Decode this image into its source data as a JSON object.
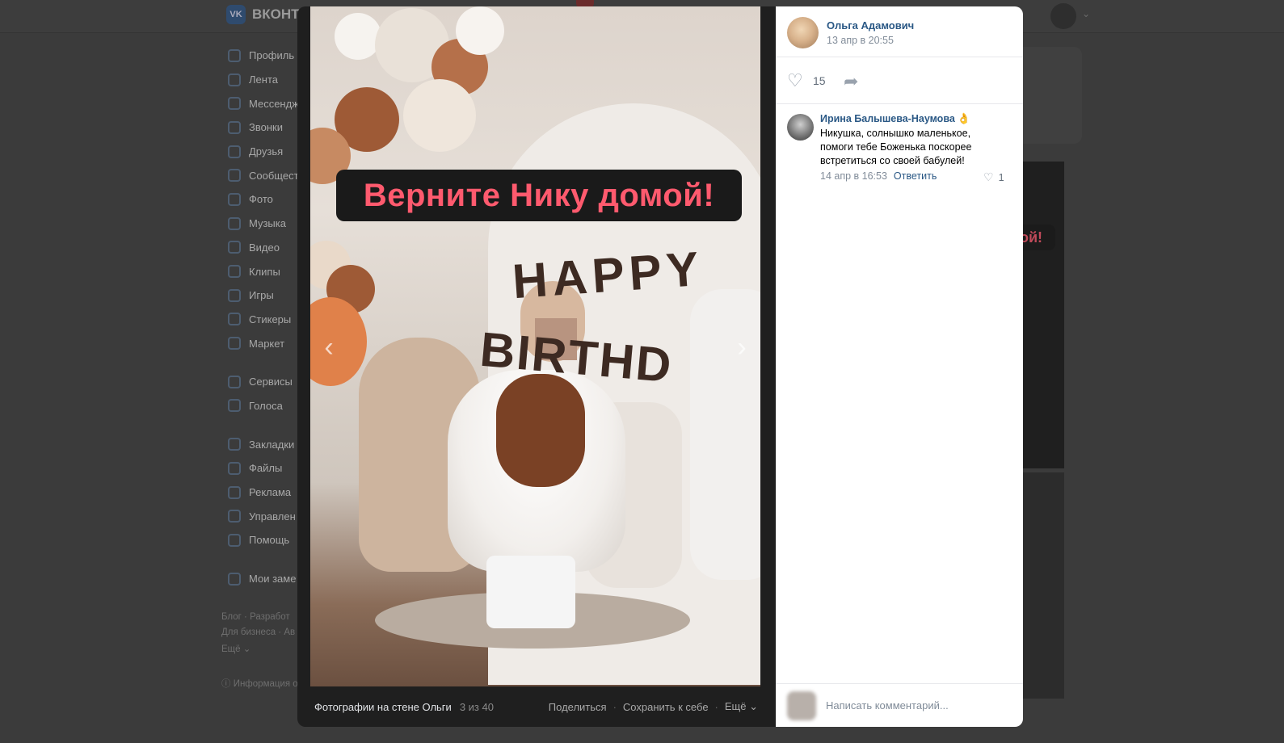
{
  "background": {
    "brand": "ВКОНТ",
    "sidebar": [
      {
        "label": "Профиль"
      },
      {
        "label": "Лента"
      },
      {
        "label": "Мессендж"
      },
      {
        "label": "Звонки"
      },
      {
        "label": "Друзья"
      },
      {
        "label": "Сообщест"
      },
      {
        "label": "Фото"
      },
      {
        "label": "Музыка"
      },
      {
        "label": "Видео"
      },
      {
        "label": "Клипы"
      },
      {
        "label": "Игры"
      },
      {
        "label": "Стикеры"
      },
      {
        "label": "Маркет"
      },
      {
        "label": "Сервисы"
      },
      {
        "label": "Голоса"
      },
      {
        "label": "Закладки"
      },
      {
        "label": "Файлы"
      },
      {
        "label": "Реклама"
      },
      {
        "label": "Управлен"
      },
      {
        "label": "Помощь"
      },
      {
        "label": "Мои заме"
      }
    ],
    "footer_line1": "Блог · Разработ",
    "footer_line2": "Для бизнеса · Ав",
    "footer_more": "Ещё ⌄",
    "footer_info": "ⓘ Информация о",
    "feed_snippet": "ой!"
  },
  "photo": {
    "overlay_text": "Верните Нику домой!",
    "decor_line1": "HAPPY",
    "decor_line2": "BIRTHD"
  },
  "photo_bar": {
    "album": "Фотографии на стене Ольги",
    "counter": "3 из 40",
    "share": "Поделиться",
    "save": "Сохранить к себе",
    "more": "Ещё ⌄"
  },
  "post": {
    "author": "Ольга Адамович",
    "date": "13 апр в 20:55",
    "likes": "15"
  },
  "comments": [
    {
      "author": "Ирина Балышева-Наумова",
      "emoji": "👌",
      "lines": [
        "Никушка, солнышко маленькое,",
        "помоги тебе Боженька поскорее",
        "встретиться со своей бабулей!"
      ],
      "date": "14 апр в 16:53",
      "reply": "Ответить",
      "likes": "1"
    }
  ],
  "compose": {
    "placeholder": "Написать комментарий..."
  },
  "colors": {
    "link": "#2a5885",
    "banner_text": "#ff5a6e",
    "overlay": "#3b3b3b"
  }
}
